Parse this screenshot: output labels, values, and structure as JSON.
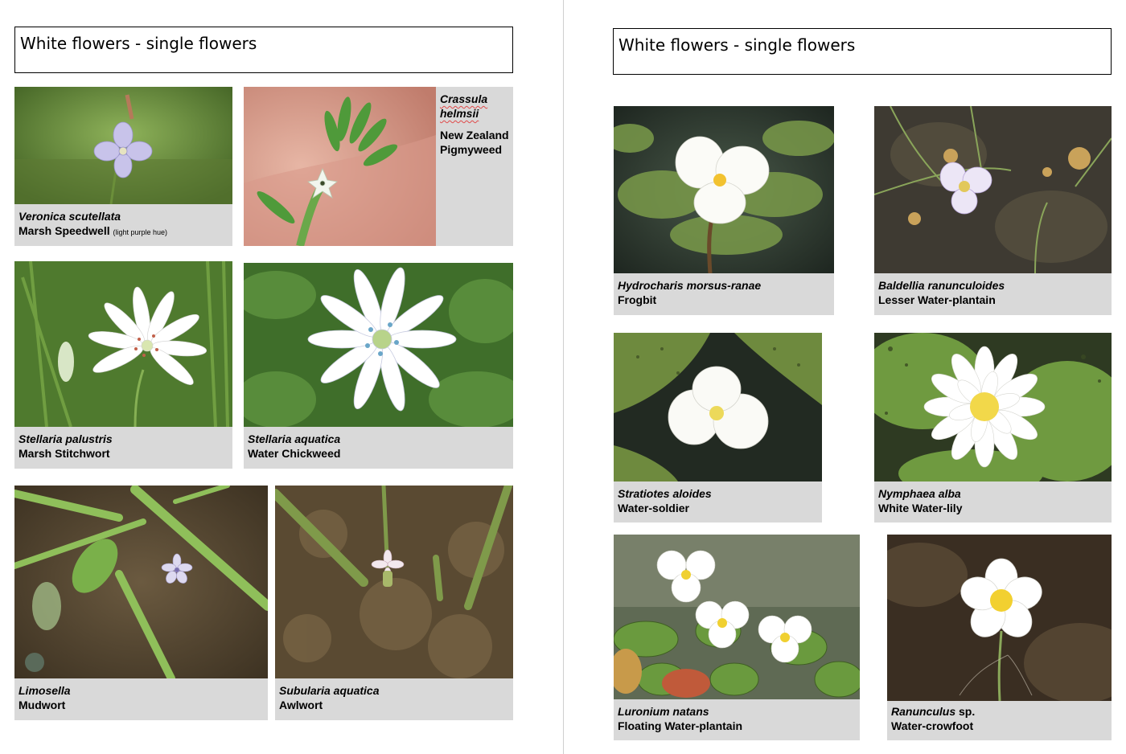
{
  "pages": [
    {
      "title": "White flowers - single flowers",
      "cards": [
        {
          "scientific": "Veronica scutellata",
          "common": "Marsh Speedwell",
          "note": "(light purple hue)"
        },
        {
          "scientific": "Crassula helmsii",
          "common": "New Zealand Pigmyweed"
        },
        {
          "scientific": "Stellaria palustris",
          "common": "Marsh Stitchwort"
        },
        {
          "scientific": "Stellaria aquatica",
          "common": "Water Chickweed"
        },
        {
          "scientific": "Limosella",
          "common": "Mudwort"
        },
        {
          "scientific": "Subularia aquatica",
          "common": "Awlwort"
        }
      ]
    },
    {
      "title": "White flowers - single flowers",
      "cards": [
        {
          "scientific": "Hydrocharis morsus-ranae",
          "common": "Frogbit"
        },
        {
          "scientific": "Baldellia ranunculoides",
          "common": "Lesser Water-plantain"
        },
        {
          "scientific": "Stratiotes aloides",
          "common": "Water-soldier"
        },
        {
          "scientific": "Nymphaea alba",
          "common": "White Water-lily"
        },
        {
          "scientific": "Luronium natans",
          "common": "Floating Water-plantain"
        },
        {
          "scientific": "Ranunculus",
          "suffix": "sp.",
          "common": "Water-crowfoot"
        }
      ]
    }
  ]
}
